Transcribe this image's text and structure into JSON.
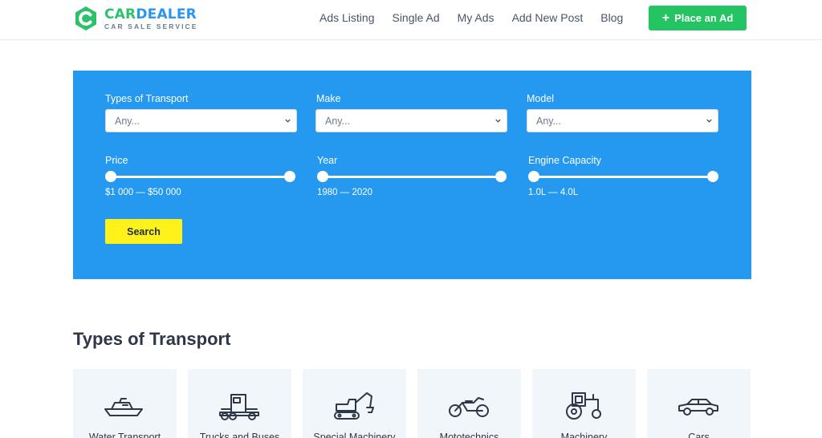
{
  "brand": {
    "name_part1": "CAR",
    "name_part2": "DEALER",
    "tagline": "CAR SALE SERVICE",
    "logo_icon": "c-letter-logo",
    "color_green": "#2ec16b",
    "color_blue": "#2b95f0"
  },
  "nav": {
    "items": [
      "Ads Listing",
      "Single Ad",
      "My Ads",
      "Add New Post",
      "Blog"
    ],
    "place_ad_icon": "plus-icon",
    "place_ad_label": "Place an Ad",
    "place_ad_color": "#24c463"
  },
  "search": {
    "panel_color": "#2599f0",
    "selects": [
      {
        "label": "Types of Transport",
        "value": "Any..."
      },
      {
        "label": "Make",
        "value": "Any..."
      },
      {
        "label": "Model",
        "value": "Any..."
      }
    ],
    "ranges": [
      {
        "label": "Price",
        "value_text": "$1 000 — $50 000",
        "low": 1000,
        "high": 50000
      },
      {
        "label": "Year",
        "value_text": "1980 — 2020",
        "low": 1980,
        "high": 2020
      },
      {
        "label": "Engine Capacity",
        "value_text": "1.0L — 4.0L",
        "low": 1.0,
        "high": 4.0
      }
    ],
    "button_label": "Search",
    "button_color": "#fff11a"
  },
  "types": {
    "title": "Types of Transport",
    "items": [
      {
        "label": "Water Transport",
        "icon": "boat-icon"
      },
      {
        "label": "Trucks and Buses",
        "icon": "truck-icon"
      },
      {
        "label": "Special Machinery",
        "icon": "excavator-icon"
      },
      {
        "label": "Mototechnics",
        "icon": "motorcycle-icon"
      },
      {
        "label": "Machinery",
        "icon": "tractor-icon"
      },
      {
        "label": "Cars",
        "icon": "car-icon"
      }
    ]
  }
}
